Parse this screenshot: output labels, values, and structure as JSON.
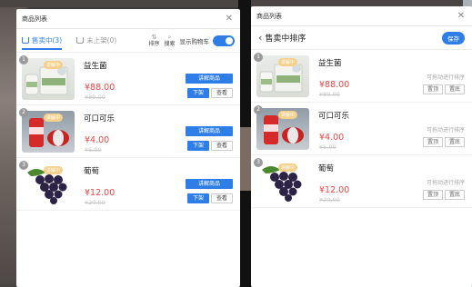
{
  "panel_list": {
    "title": "商品列表",
    "tabs": [
      {
        "label": "售卖中(3)",
        "active": true
      },
      {
        "label": "未上架(0)",
        "active": false
      }
    ],
    "tools": {
      "sort": "排序",
      "search": "搜索",
      "show_cart": "显示购物车"
    },
    "toggle_on": true
  },
  "panel_sort": {
    "title": "商品列表",
    "header": "售卖中排序",
    "save": "保存",
    "drag_hint": "可拖动进行排序",
    "btn_top": "置顶",
    "btn_bottom": "置底"
  },
  "products": [
    {
      "num": "1",
      "badge": "讲解中",
      "name": "益生菌",
      "price": "¥88.00",
      "orig_price": "¥89.00"
    },
    {
      "num": "2",
      "badge": "讲解中",
      "name": "可口可乐",
      "price": "¥4.00",
      "orig_price": "¥5.00"
    },
    {
      "num": "3",
      "badge": "讲解中",
      "name": "葡萄",
      "price": "¥12.00",
      "orig_price": "¥20.00"
    }
  ],
  "actions": {
    "explain": "讲解商品",
    "off_shelf": "下架",
    "view": "查看"
  },
  "colors": {
    "accent": "#2f7ee7",
    "price": "#f04545",
    "badge": "#f4d08a"
  },
  "icons": {
    "close": "close-icon",
    "back": "chevron-left-icon",
    "cart": "cart-icon",
    "sort": "sort-icon",
    "search": "search-icon"
  }
}
